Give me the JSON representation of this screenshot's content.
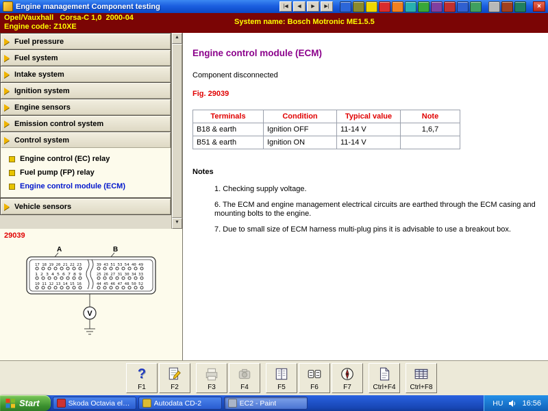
{
  "title_bar": {
    "app_title": "Engine management Component testing",
    "nav": {
      "first": "|◀",
      "prev": "◀",
      "next": "▶",
      "last": "▶|"
    },
    "close_label": "×"
  },
  "header": {
    "vehicle_line1": "Opel/Vauxhall   Corsa-C 1,0  2000-04",
    "vehicle_line2": "Engine code: Z10XE",
    "system_name": "System name: Bosch Motronic ME1.5.5"
  },
  "sidebar": {
    "items": [
      "Fuel pressure",
      "Fuel system",
      "Intake system",
      "Ignition system",
      "Engine sensors",
      "Emission control system",
      "Control system",
      "Vehicle sensors"
    ],
    "submenu": [
      {
        "label": "Engine control (EC) relay",
        "selected": false
      },
      {
        "label": "Fuel pump (FP) relay",
        "selected": false
      },
      {
        "label": "Engine control module (ECM)",
        "selected": true
      }
    ],
    "figure_number": "29039"
  },
  "diagram": {
    "block_a_label": "A",
    "block_b_label": "B",
    "pins_a_row1": "17 18 19 20 21 22 23",
    "pins_a_row2": "1 2 3 4 5 6 7 8 9",
    "pins_a_row3": "10 11 12 13 14 15 16",
    "pins_b_row1": "39 43 51 53 54 40 49",
    "pins_b_row2": "25 26 27 31 30 34 33",
    "pins_b_row3": "44 45 46 47 48 50 52",
    "meter_label": "V"
  },
  "content": {
    "title": "Engine control module (ECM)",
    "status_line": "Component disconnected",
    "figure_ref": "Fig. 29039",
    "table": {
      "headers": [
        "Terminals",
        "Condition",
        "Typical value",
        "Note"
      ],
      "rows": [
        [
          "B18 & earth",
          "Ignition OFF",
          "11-14 V",
          "1,6,7"
        ],
        [
          "B51 & earth",
          "Ignition ON",
          "11-14 V",
          ""
        ]
      ]
    },
    "notes_heading": "Notes",
    "notes": [
      "1. Checking supply voltage.",
      "6. The ECM and engine management electrical circuits are earthed through the ECM casing and mounting bolts to the engine.",
      "7. Due to small size of ECM harness multi-plug pins it is advisable to use a breakout box."
    ]
  },
  "fkeys": [
    {
      "label": "F1"
    },
    {
      "label": "F2"
    },
    {
      "label": "F3"
    },
    {
      "label": "F4"
    },
    {
      "label": "F5"
    },
    {
      "label": "F6"
    },
    {
      "label": "F7"
    },
    {
      "label": "Ctrl+F4"
    },
    {
      "label": "Ctrl+F8"
    }
  ],
  "taskbar": {
    "start_label": "Start",
    "tasks": [
      {
        "label": "Skoda Octavia elektr...",
        "active": false
      },
      {
        "label": "Autodata CD-2",
        "active": false
      },
      {
        "label": "EC2 - Paint",
        "active": true
      }
    ],
    "tray": {
      "language": "HU",
      "time": "16:56"
    }
  },
  "colors": {
    "titlebar_blue": "#1c5fe0",
    "header_maroon": "#7b0505",
    "header_text_yellow": "#ffff00",
    "title_purple": "#8b008b",
    "accent_red": "#e00000",
    "selected_item_blue": "#0016cc",
    "panel_tan": "#e7e3d1",
    "cream": "#fdfbec"
  }
}
